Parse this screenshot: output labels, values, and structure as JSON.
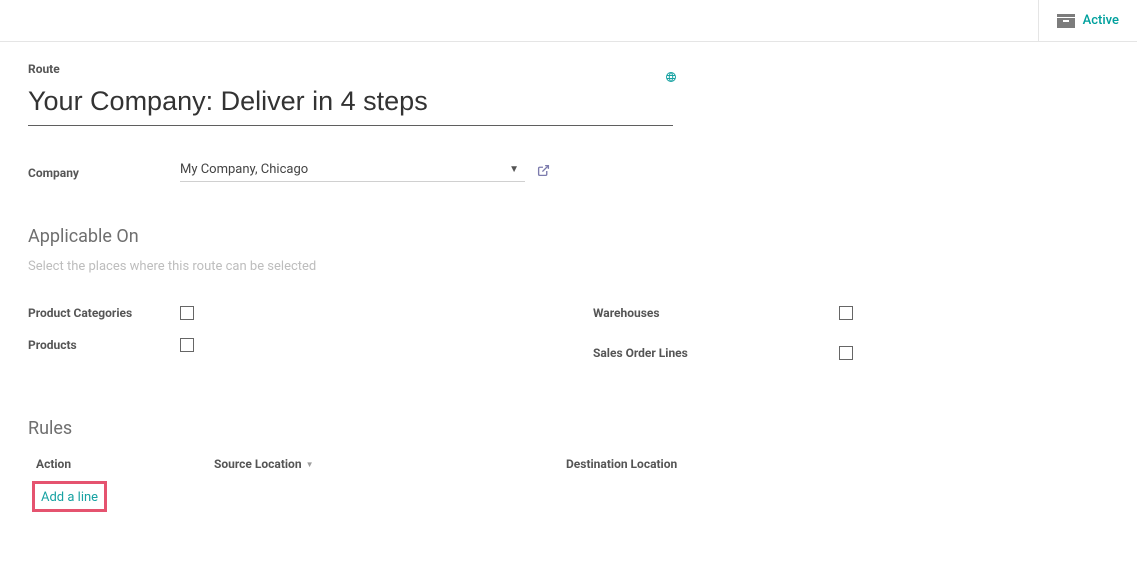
{
  "topbar": {
    "active_label": "Active"
  },
  "route": {
    "field_label": "Route",
    "name": "Your Company: Deliver in 4 steps"
  },
  "company": {
    "label": "Company",
    "value": "My Company, Chicago"
  },
  "applicable": {
    "title": "Applicable On",
    "hint": "Select the places where this route can be selected",
    "checks": {
      "product_categories": "Product Categories",
      "products": "Products",
      "warehouses": "Warehouses",
      "sales_order_lines": "Sales Order Lines"
    }
  },
  "rules": {
    "title": "Rules",
    "columns": {
      "action": "Action",
      "source": "Source Location",
      "destination": "Destination Location"
    },
    "add_line": "Add a line"
  }
}
